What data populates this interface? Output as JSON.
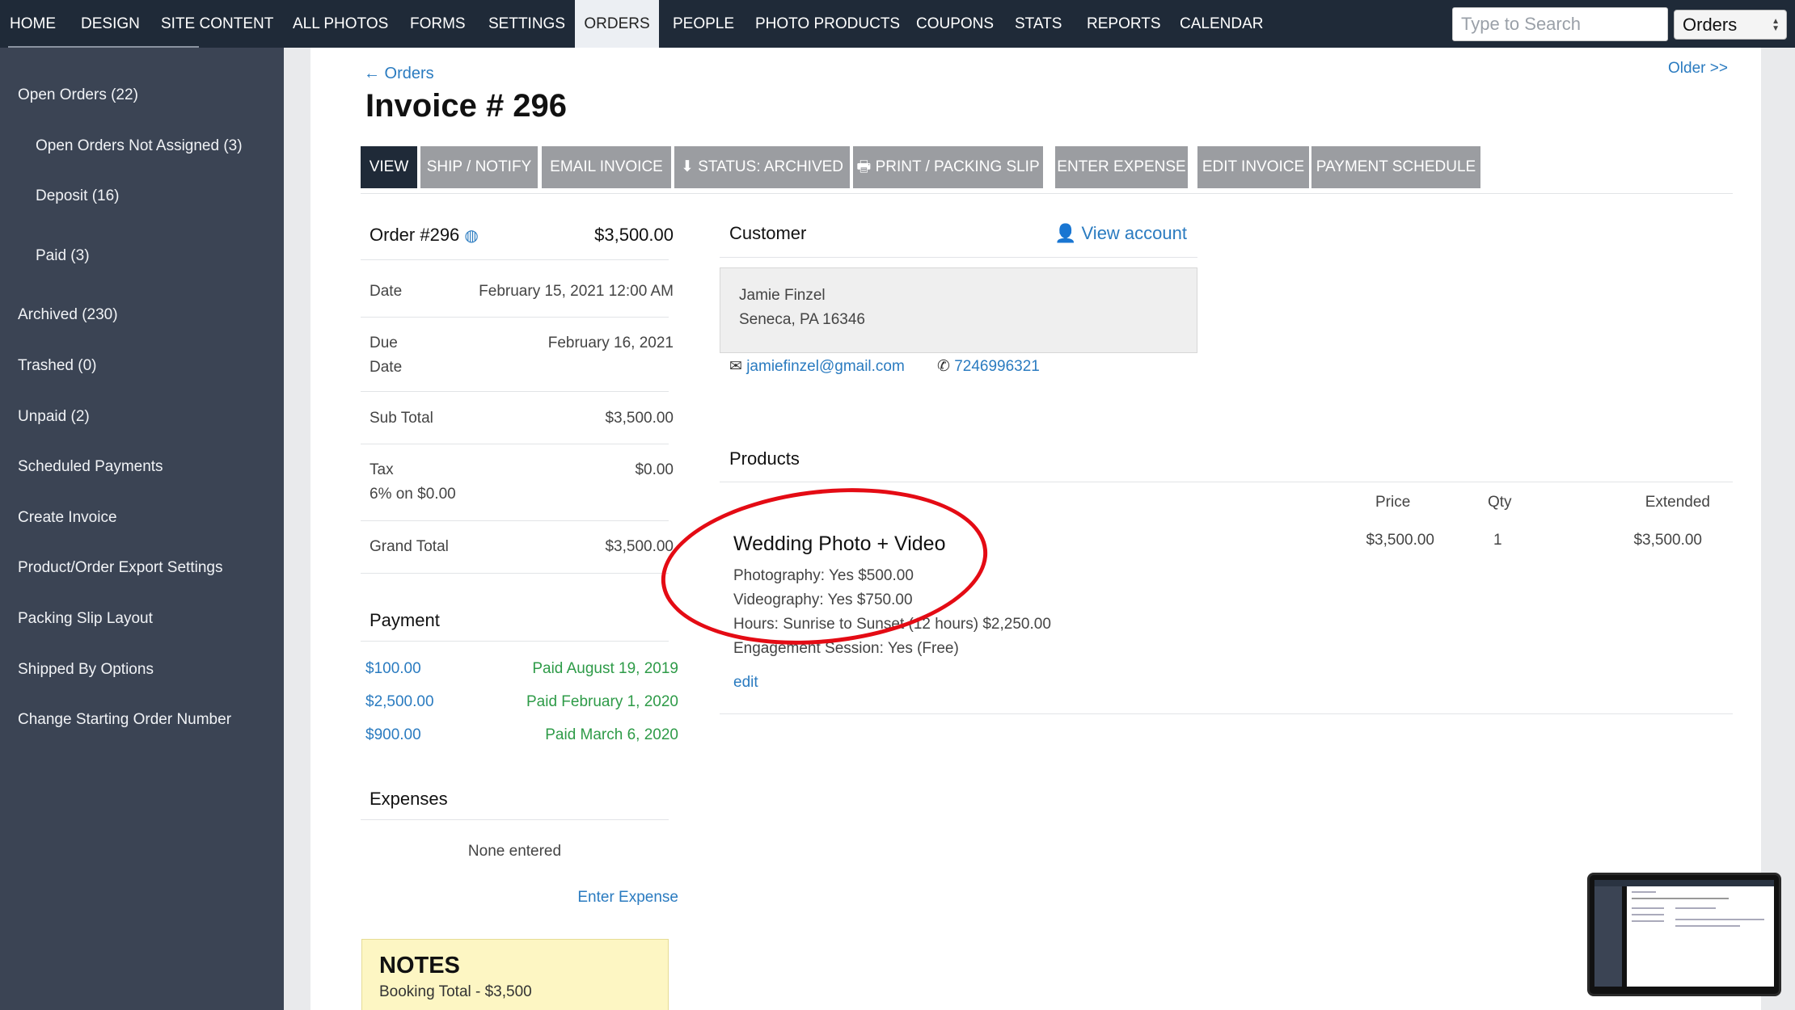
{
  "nav": {
    "items": [
      "HOME",
      "DESIGN",
      "SITE CONTENT",
      "ALL PHOTOS",
      "FORMS",
      "SETTINGS",
      "ORDERS",
      "PEOPLE",
      "PHOTO PRODUCTS",
      "COUPONS",
      "STATS",
      "REPORTS",
      "CALENDAR"
    ],
    "active": "ORDERS",
    "search_placeholder": "Type to Search",
    "select_value": "Orders"
  },
  "sidebar": {
    "items": [
      "Open Orders (22)",
      "Open Orders Not Assigned (3)",
      "Deposit (16)",
      "Paid (3)",
      "Archived (230)",
      "Trashed (0)",
      "Unpaid (2)",
      "Scheduled Payments",
      "Create Invoice",
      "Product/Order Export Settings",
      "Packing Slip Layout",
      "Shipped By Options",
      "Change Starting Order Number"
    ]
  },
  "header": {
    "back_link": "← Orders",
    "title": "Invoice # 296",
    "older_link": "Older >>"
  },
  "tabs": [
    "VIEW",
    "SHIP / NOTIFY",
    "EMAIL INVOICE",
    "STATUS: ARCHIVED",
    "PRINT / PACKING SLIP",
    "ENTER EXPENSE",
    "EDIT INVOICE",
    "PAYMENT SCHEDULE"
  ],
  "order": {
    "label": "Order #296",
    "amount": "$3,500.00",
    "date_label": "Date",
    "date_value": "February 15, 2021 12:00 AM",
    "due_label_1": "Due",
    "due_label_2": "Date",
    "due_value": "February 16, 2021",
    "subtotal_label": "Sub Total",
    "subtotal_value": "$3,500.00",
    "tax_label": "Tax",
    "tax_detail": "6% on $0.00",
    "tax_value": "$0.00",
    "grand_label": "Grand Total",
    "grand_value": "$3,500.00"
  },
  "payment": {
    "title": "Payment",
    "rows": [
      {
        "amount": "$100.00",
        "status": "Paid August 19, 2019"
      },
      {
        "amount": "$2,500.00",
        "status": "Paid February 1, 2020"
      },
      {
        "amount": "$900.00",
        "status": "Paid March 6, 2020"
      }
    ]
  },
  "expenses": {
    "title": "Expenses",
    "empty": "None entered",
    "link": "Enter Expense"
  },
  "notes": {
    "title": "NOTES",
    "text": "Booking Total - $3,500"
  },
  "customer": {
    "title": "Customer",
    "view_account": "View account",
    "name": "Jamie Finzel",
    "address": "Seneca, PA 16346",
    "email": "jamiefinzel@gmail.com",
    "phone": "7246996321"
  },
  "products": {
    "title": "Products",
    "headers": {
      "price": "Price",
      "qty": "Qty",
      "extended": "Extended"
    },
    "item": {
      "name": "Wedding Photo + Video",
      "options": [
        "Photography: Yes $500.00",
        "Videography: Yes $750.00",
        "Hours: Sunrise to Sunset (12 hours) $2,250.00",
        "Engagement Session: Yes (Free)"
      ],
      "edit": "edit",
      "price": "$3,500.00",
      "qty": "1",
      "extended": "$3,500.00"
    }
  },
  "colors": {
    "nav_bg": "#1f2a38",
    "sidebar_bg": "#3b4454",
    "link": "#2a7bc0",
    "paid_green": "#2e9b48",
    "annotation_red": "#e40b14",
    "notes_bg": "#fdf6c3"
  }
}
